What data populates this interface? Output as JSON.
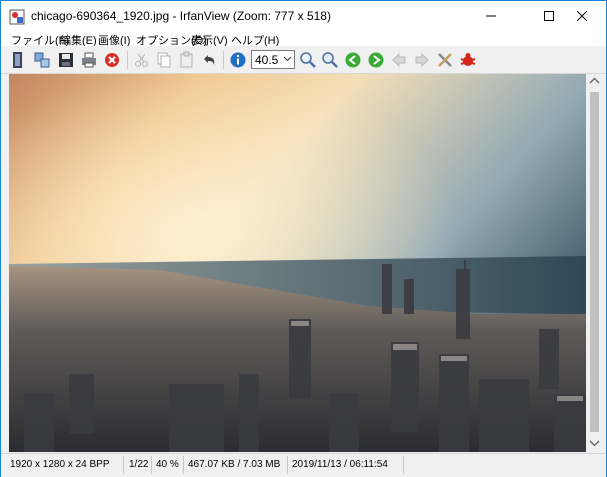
{
  "window": {
    "title": "chicago-690364_1920.jpg - IrfanView (Zoom: 777 x 518)"
  },
  "menu": [
    {
      "label": "ファイル(F)"
    },
    {
      "label": "編集(E)"
    },
    {
      "label": "画像(I)"
    },
    {
      "label": "オプション(O)"
    },
    {
      "label": "表示(V)"
    },
    {
      "label": "ヘルプ(H)"
    }
  ],
  "toolbar": {
    "zoom_value": "40.5",
    "icons": [
      "open-icon",
      "thumbnails-icon",
      "save-icon",
      "print-icon",
      "delete-icon",
      "cut-icon",
      "copy-icon",
      "paste-icon",
      "undo-icon",
      "info-icon",
      "zoom-in-icon",
      "zoom-out-icon",
      "previous-icon",
      "next-icon",
      "rotate-left-icon",
      "rotate-right-icon",
      "settings-icon",
      "irfanview-logo-icon"
    ]
  },
  "status": {
    "dimensions": "1920 x 1280 x 24 BPP",
    "index": "1/22",
    "zoom": "40 %",
    "size": "467.07 KB / 7.03 MB",
    "datetime": "2019/11/13 / 06:11:54"
  },
  "colors": {
    "accent": "#1883d7",
    "delete": "#d9302c",
    "info": "#1f6fc5",
    "nav_green": "#3aaa35"
  }
}
